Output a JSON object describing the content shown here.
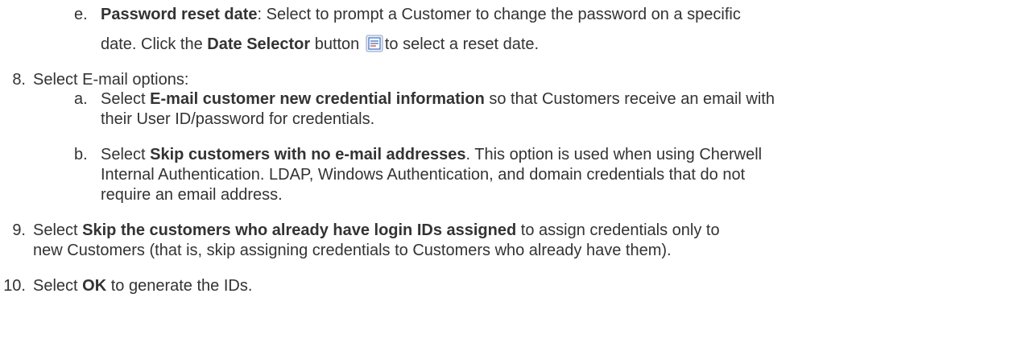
{
  "steps": {
    "e": {
      "marker": "e.",
      "bold1": "Password reset date",
      "t1": ": Select to prompt a Customer to change the password on a specific",
      "t2": "date. Click the ",
      "bold2": "Date Selector",
      "t3": " button",
      "t4": "to select a reset date.",
      "icon": "calendar-date-selector-icon"
    },
    "s8": {
      "marker": "8.",
      "text": "Select E-mail options:"
    },
    "a": {
      "marker": "a.",
      "t1": "Select ",
      "bold": "E-mail customer new credential information",
      "t2": " so that Customers receive an email with",
      "t3": "their User ID/password for credentials."
    },
    "b": {
      "marker": "b.",
      "t1": "Select ",
      "bold": "Skip customers with no e-mail addresses",
      "t2": ". This option is used when using Cherwell",
      "l2": "Internal Authentication. LDAP, Windows Authentication, and domain credentials that do not",
      "l3": "require an email address."
    },
    "s9": {
      "marker": "9.",
      "t1": "Select ",
      "bold": "Skip the customers who already have login IDs assigned",
      "t2": " to assign credentials only to",
      "l2": "new Customers (that is, skip assigning credentials to Customers who already have them)."
    },
    "s10": {
      "marker": "10.",
      "t1": "Select ",
      "bold": "OK",
      "t2": " to generate the IDs."
    }
  },
  "colors": {
    "text": "#333333",
    "icon_blue": "#3f6fbf",
    "icon_red": "#d24b3e"
  }
}
